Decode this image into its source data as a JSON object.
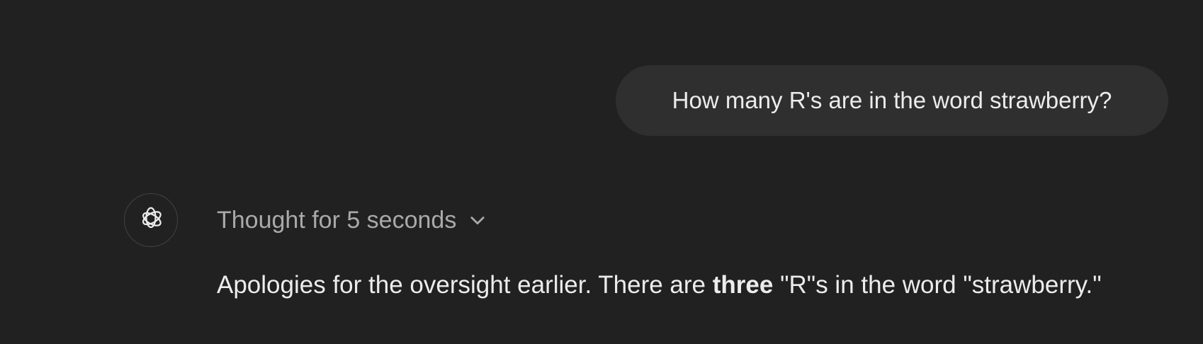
{
  "user_message": {
    "text": "How many R's are in the word strawberry?"
  },
  "assistant": {
    "avatar_icon": "openai-logo-icon",
    "thought": {
      "label": "Thought for 5 seconds",
      "toggle_icon": "chevron-down-icon"
    },
    "response": {
      "before": "Apologies for the oversight earlier. There are ",
      "bold": "three",
      "after": " \"R\"s in the word \"strawberry.\""
    }
  },
  "colors": {
    "background": "#212121",
    "user_bubble": "#2f2f2f",
    "text_primary": "#ececec",
    "text_muted": "#a9a9a9"
  }
}
